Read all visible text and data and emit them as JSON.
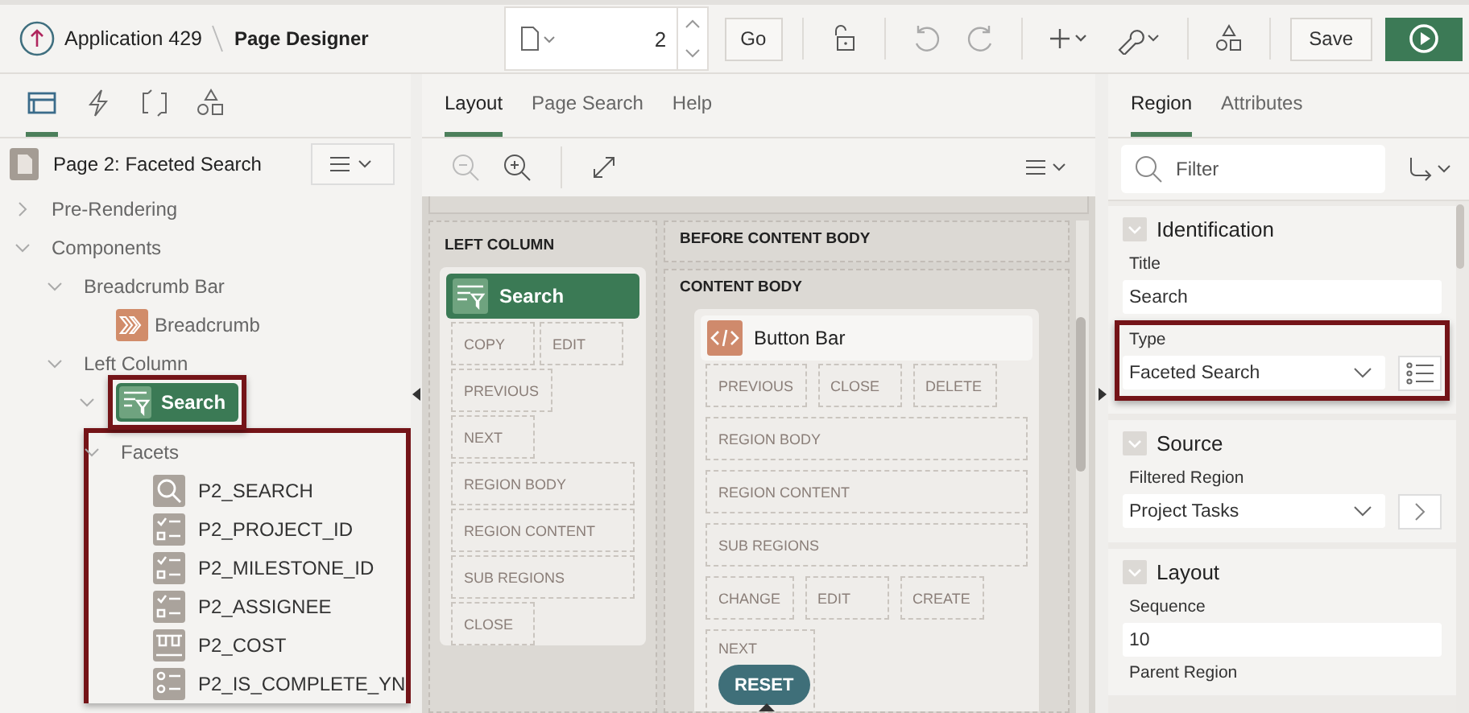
{
  "header": {
    "app": "Application 429",
    "page": "Page Designer",
    "page_number": "2",
    "go": "Go",
    "save": "Save"
  },
  "left_tabs": [
    {
      "kind": "rendering",
      "selected": true
    },
    {
      "kind": "dynamic",
      "selected": false
    },
    {
      "kind": "processing",
      "selected": false
    },
    {
      "kind": "shared",
      "selected": false
    }
  ],
  "tree": {
    "page": "Page 2: Faceted Search",
    "nodes": [
      {
        "label": "Pre-Rendering",
        "expanded": false,
        "selected": false
      },
      {
        "label": "Components",
        "expanded": true,
        "selected": false,
        "children": [
          {
            "label": "Breadcrumb Bar",
            "expanded": true,
            "selected": false,
            "children": [
              {
                "label": "Breadcrumb",
                "kind": "breadcrumb",
                "selected": false
              }
            ]
          },
          {
            "label": "Left Column",
            "expanded": true,
            "selected": false,
            "children": [
              {
                "label": "Search",
                "kind": "facets",
                "selected": true,
                "expanded": true,
                "framed": true,
                "children": [
                  {
                    "label": "Facets",
                    "expanded": true,
                    "selected": false,
                    "framed_group": true,
                    "children": [
                      {
                        "label": "P2_SEARCH",
                        "kind": "search",
                        "selected": false
                      },
                      {
                        "label": "P2_PROJECT_ID",
                        "kind": "checkbox",
                        "selected": false
                      },
                      {
                        "label": "P2_MILESTONE_ID",
                        "kind": "checkbox",
                        "selected": false
                      },
                      {
                        "label": "P2_ASSIGNEE",
                        "kind": "checkbox",
                        "selected": false
                      },
                      {
                        "label": "P2_COST",
                        "kind": "range",
                        "selected": false
                      },
                      {
                        "label": "P2_IS_COMPLETE_YN",
                        "kind": "radio",
                        "selected": false
                      }
                    ]
                  }
                ]
              }
            ]
          }
        ]
      }
    ]
  },
  "mid_tabs": [
    {
      "label": "Layout",
      "selected": true
    },
    {
      "label": "Page Search",
      "selected": false
    },
    {
      "label": "Help",
      "selected": false
    }
  ],
  "layout": {
    "left_column": {
      "title": "LEFT COLUMN",
      "region": "Search",
      "slots": [
        {
          "label": "COPY",
          "wide": false
        },
        {
          "label": "EDIT",
          "wide": false
        },
        {
          "label": "PREVIOUS",
          "wide": false
        },
        {
          "label": "NEXT",
          "wide": false
        },
        {
          "label": "REGION BODY",
          "wide": true
        },
        {
          "label": "REGION CONTENT",
          "wide": true
        },
        {
          "label": "SUB REGIONS",
          "wide": true
        },
        {
          "label": "CLOSE",
          "wide": false
        }
      ]
    },
    "before_content_body": "BEFORE CONTENT BODY",
    "content_body": {
      "title": "CONTENT BODY",
      "region": "Button Bar",
      "slots": [
        {
          "label": "PREVIOUS",
          "wide": false
        },
        {
          "label": "CLOSE",
          "wide": false
        },
        {
          "label": "DELETE",
          "wide": false
        },
        {
          "label": "REGION BODY",
          "wide": true
        },
        {
          "label": "REGION CONTENT",
          "wide": true
        },
        {
          "label": "SUB REGIONS",
          "wide": true
        },
        {
          "label": "CHANGE",
          "wide": false
        },
        {
          "label": "EDIT",
          "wide": false
        },
        {
          "label": "CREATE",
          "wide": false
        },
        {
          "label": "NEXT",
          "wide": false,
          "button": "RESET"
        }
      ]
    }
  },
  "right_tabs": [
    {
      "label": "Region",
      "selected": true
    },
    {
      "label": "Attributes",
      "selected": false
    }
  ],
  "filter": {
    "placeholder": "Filter"
  },
  "sections": [
    {
      "title": "Identification",
      "fields": [
        {
          "label": "Title",
          "kind": "text",
          "value": "Search"
        },
        {
          "label": "Type",
          "kind": "select",
          "value": "Faceted Search",
          "side": {
            "kind": "list"
          },
          "outlined": true
        }
      ]
    },
    {
      "title": "Source",
      "fields": [
        {
          "label": "Filtered Region",
          "kind": "select",
          "value": "Project Tasks",
          "side": {
            "kind": "go"
          },
          "outlined": false
        }
      ]
    },
    {
      "title": "Layout",
      "fields": [
        {
          "label": "Sequence",
          "kind": "text",
          "value": "10"
        },
        {
          "label": "Parent Region",
          "kind": "label"
        }
      ]
    }
  ]
}
